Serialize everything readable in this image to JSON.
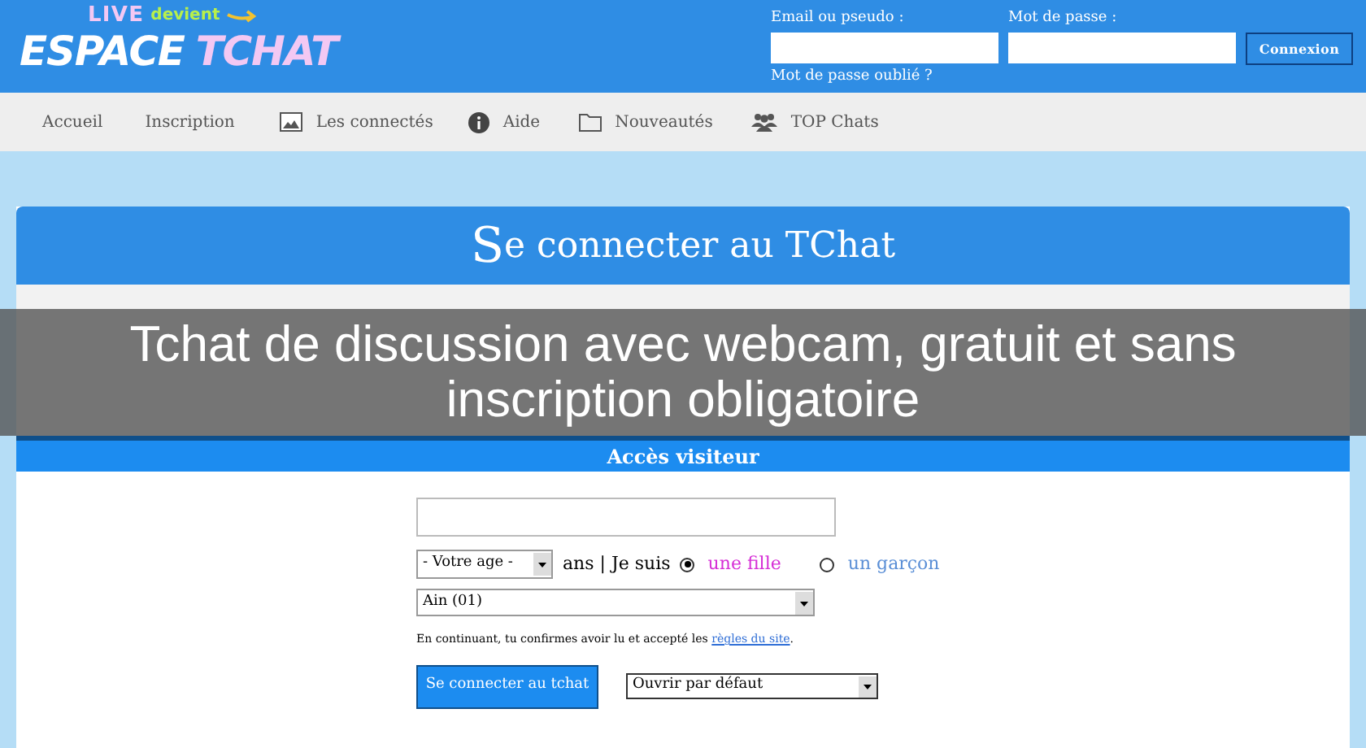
{
  "logo": {
    "top": "LIVE",
    "tag": "devient",
    "main_1": "ESPACE",
    "main_2": "TCHAT"
  },
  "login": {
    "email_label": "Email ou pseudo :",
    "password_label": "Mot de passe :",
    "button": "Connexion",
    "forgot": "Mot de passe oublié ?"
  },
  "nav": [
    {
      "label": "Accueil"
    },
    {
      "label": "Inscription"
    },
    {
      "label": "Les connectés"
    },
    {
      "label": "Aide"
    },
    {
      "label": "Nouveautés"
    },
    {
      "label": "TOP Chats"
    }
  ],
  "card": {
    "title_initial": "S",
    "title_rest": "e connecter au TChat",
    "section": "Accès visiteur"
  },
  "form": {
    "age_select": "- Votre age -",
    "age_suffix": "ans | Je suis",
    "genders": [
      {
        "label": "une fille",
        "selected": true,
        "color": "#d62fd6"
      },
      {
        "label": "un garçon",
        "selected": false,
        "color": "#5b8fd6"
      }
    ],
    "region_select": "Ain (01)",
    "notice": "En continuant, tu confirmes avoir lu et accepté les",
    "rules_link": "règles du site",
    "notice_end": ".",
    "submit": "Se connecter au tchat",
    "open_select": "Ouvrir par défaut"
  },
  "caption": "Tchat de discussion avec webcam, gratuit et sans inscription obligatoire"
}
